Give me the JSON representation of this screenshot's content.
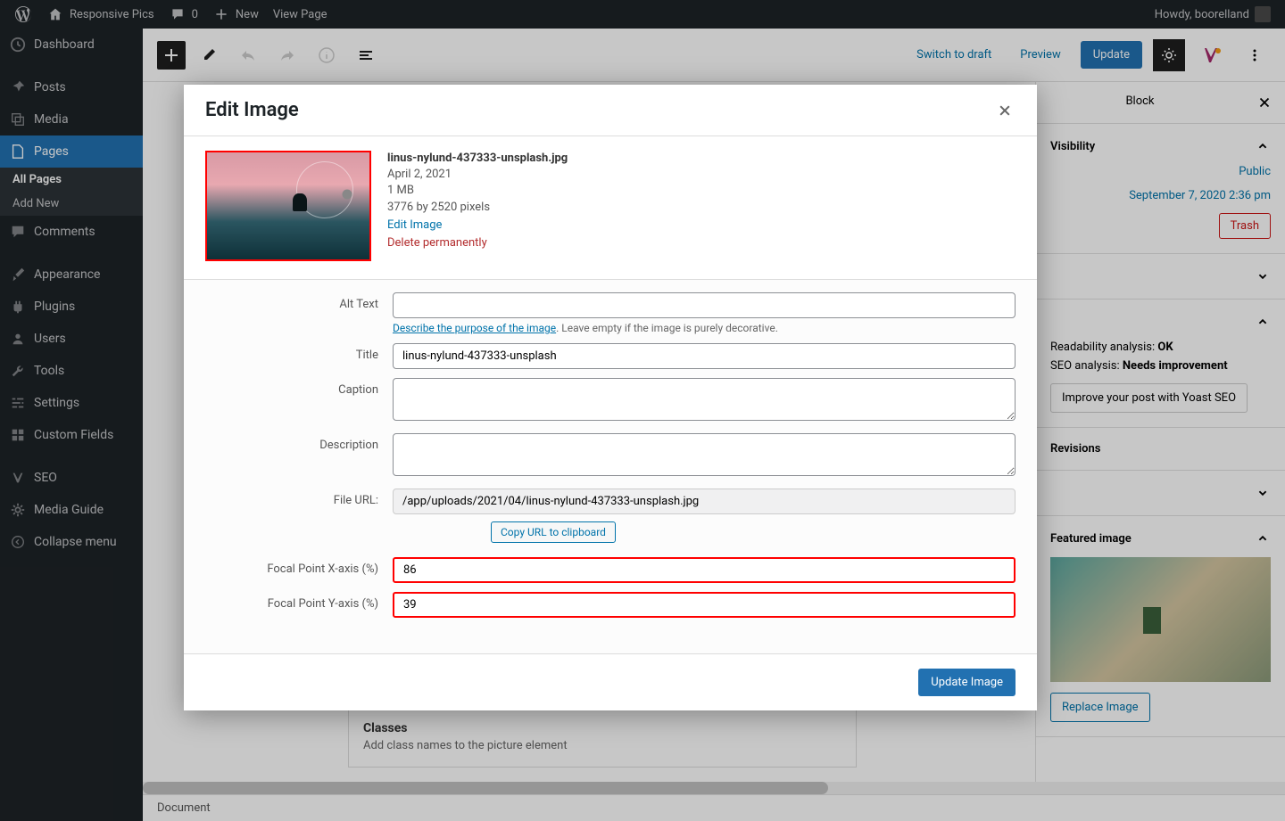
{
  "adminbar": {
    "site_name": "Responsive Pics",
    "comments_count": "0",
    "new_label": "New",
    "view_page": "View Page",
    "howdy": "Howdy, boorelland"
  },
  "sidebar": {
    "dashboard": "Dashboard",
    "posts": "Posts",
    "media": "Media",
    "pages": "Pages",
    "all_pages": "All Pages",
    "add_new": "Add New",
    "comments": "Comments",
    "appearance": "Appearance",
    "plugins": "Plugins",
    "users": "Users",
    "tools": "Tools",
    "settings": "Settings",
    "custom_fields": "Custom Fields",
    "seo": "SEO",
    "media_guide": "Media Guide",
    "collapse": "Collapse menu"
  },
  "topbar": {
    "switch_draft": "Switch to draft",
    "preview": "Preview",
    "update": "Update"
  },
  "rightpanel": {
    "block_tab": "Block",
    "visibility_label": "Visibility",
    "visibility_value": "Public",
    "publish_value": "September 7, 2020 2:36 pm",
    "trash": "Trash",
    "readability_label": "Readability analysis:",
    "readability_value": "OK",
    "seo_label": "SEO analysis:",
    "seo_value": "Needs improvement",
    "yoast_btn": "Improve your post with Yoast SEO",
    "revisions": "Revisions",
    "featured_image": "Featured image",
    "replace_image": "Replace Image"
  },
  "content": {
    "classes_heading": "Classes",
    "classes_sub": "Add class names to the picture element"
  },
  "bottombar": {
    "document": "Document"
  },
  "modal": {
    "title": "Edit Image",
    "filename": "linus-nylund-437333-unsplash.jpg",
    "date": "April 2, 2021",
    "filesize": "1 MB",
    "dimensions": "3776 by 2520 pixels",
    "edit_image": "Edit Image",
    "delete": "Delete permanently",
    "alt_label": "Alt Text",
    "alt_help_link": "Describe the purpose of the image",
    "alt_help_rest": ". Leave empty if the image is purely decorative.",
    "title_label": "Title",
    "title_value": "linus-nylund-437333-unsplash",
    "caption_label": "Caption",
    "description_label": "Description",
    "fileurl_label": "File URL:",
    "fileurl_value": "/app/uploads/2021/04/linus-nylund-437333-unsplash.jpg",
    "copy_url": "Copy URL to clipboard",
    "fp_x_label": "Focal Point X-axis (%)",
    "fp_x_value": "86",
    "fp_y_label": "Focal Point Y-axis (%)",
    "fp_y_value": "39",
    "update_btn": "Update Image"
  }
}
